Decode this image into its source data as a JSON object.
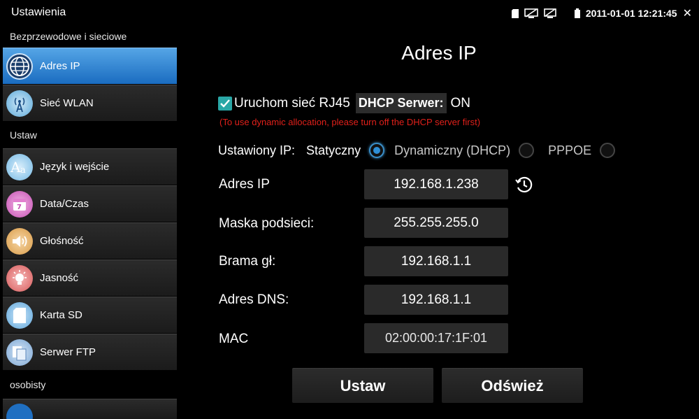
{
  "statusbar": {
    "app_title": "Ustawienia",
    "datetime": "2011-01-01 12:21:45"
  },
  "sidebar": {
    "section1": "Bezprzewodowe i sieciowe",
    "section2": "Ustaw",
    "section3": "osobisty",
    "items": [
      {
        "label": "Adres IP",
        "icon": "globe-icon"
      },
      {
        "label": "Sieć WLAN",
        "icon": "wifi-antenna-icon"
      },
      {
        "label": "Język i wejście",
        "icon": "language-icon"
      },
      {
        "label": "Data/Czas",
        "icon": "calendar-icon"
      },
      {
        "label": "Głośność",
        "icon": "speaker-icon"
      },
      {
        "label": "Jasność",
        "icon": "brightness-icon"
      },
      {
        "label": "Karta SD",
        "icon": "sd-card-icon"
      },
      {
        "label": "Serwer FTP",
        "icon": "ftp-server-icon"
      }
    ],
    "active_item": "Adres IP"
  },
  "main": {
    "title": "Adres IP",
    "rj45_label": "Uruchom sieć RJ45",
    "rj45_checked": true,
    "dhcp_server_label": "DHCP Serwer:",
    "dhcp_server_value": "ON",
    "warning": "(To use dynamic allocation, please turn off the DHCP server first)",
    "ip_mode_label": "Ustawiony IP:",
    "ip_modes": [
      "Statyczny",
      "Dynamiczny (DHCP)",
      "PPPOE"
    ],
    "ip_mode_selected": "Statyczny",
    "fields": {
      "ip_label": "Adres IP",
      "ip_value": "192.168.1.238",
      "mask_label": "Maska podsieci:",
      "mask_value": "255.255.255.0",
      "gateway_label": "Brama gł:",
      "gateway_value": "192.168.1.1",
      "dns_label": "Adres DNS:",
      "dns_value": "192.168.1.1",
      "mac_label": "MAC",
      "mac_value": "02:00:00:17:1F:01"
    },
    "buttons": {
      "set": "Ustaw",
      "refresh": "Odśwież"
    }
  },
  "colors": {
    "active_blue": "#2e8fd6",
    "checkbox_teal": "#2aa7a6",
    "warning_red": "#e0201a"
  }
}
